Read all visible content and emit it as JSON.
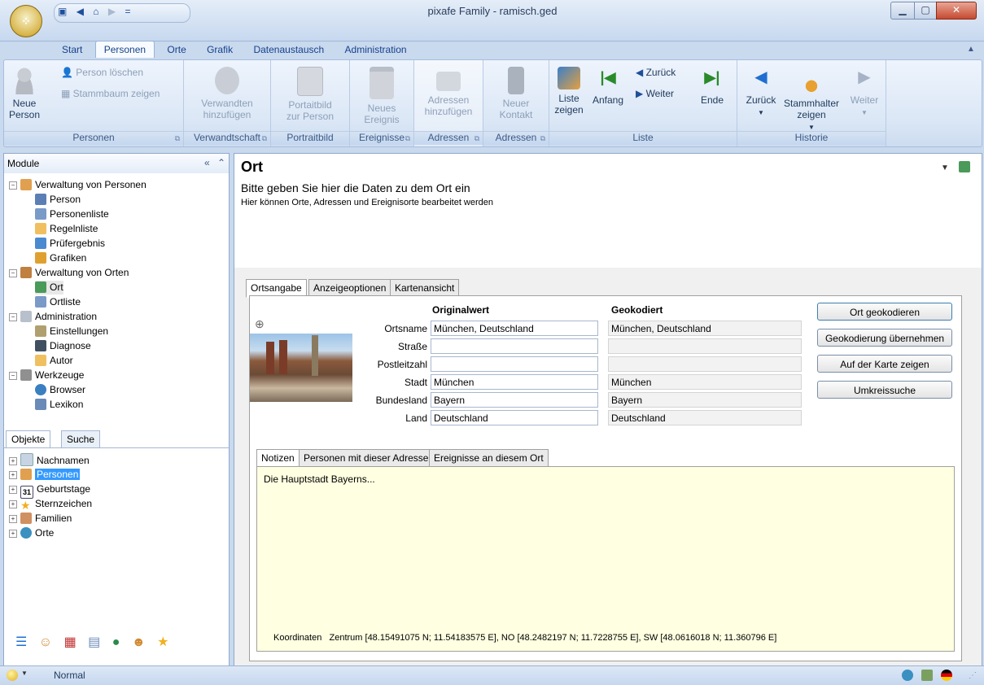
{
  "window": {
    "title": "pixafe Family - ramisch.ged"
  },
  "qat": {
    "save_icon": "save-icon",
    "back_icon": "back-arrow-icon",
    "home_icon": "home-icon",
    "forward_icon": "forward-arrow-icon",
    "customize": "="
  },
  "ribbon_tabs": [
    "Start",
    "Personen",
    "Orte",
    "Grafik",
    "Datenaustausch",
    "Administration"
  ],
  "ribbon_active_tab": "Personen",
  "ribbon": {
    "personen": {
      "label": "Personen",
      "neue_person": "Neue\nPerson",
      "person_loeschen": "Person löschen",
      "stammbaum_zeigen": "Stammbaum zeigen"
    },
    "verwandtschaft": {
      "label": "Verwandtschaft",
      "btn": "Verwandten\nhinzufügen"
    },
    "portraitbild": {
      "label": "Portraitbild",
      "btn": "Portaitbild\nzur Person"
    },
    "ereignisse": {
      "label": "Ereignisse",
      "btn": "Neues\nEreignis"
    },
    "adressen1": {
      "label": "Adressen",
      "btn": "Adressen\nhinzufügen"
    },
    "adressen2": {
      "label": "Adressen",
      "btn": "Neuer\nKontakt"
    },
    "liste": {
      "label": "Liste",
      "liste_zeigen": "Liste\nzeigen",
      "anfang": "Anfang",
      "zurueck": "Zurück",
      "weiter": "Weiter",
      "ende": "Ende"
    },
    "historie": {
      "label": "Historie",
      "zurueck": "Zurück",
      "stammhalter": "Stammhalter\nzeigen",
      "weiter": "Weiter"
    }
  },
  "modules": {
    "title": "Module",
    "tree": [
      {
        "label": "Verwaltung von Personen",
        "icon": "people-icon",
        "level": 0
      },
      {
        "label": "Person",
        "icon": "person-card-icon",
        "level": 1
      },
      {
        "label": "Personenliste",
        "icon": "list-icon",
        "level": 1
      },
      {
        "label": "Regelnliste",
        "icon": "folder-icon",
        "level": 1
      },
      {
        "label": "Prüfergebnis",
        "icon": "check-icon",
        "level": 1
      },
      {
        "label": "Grafiken",
        "icon": "chart-icon",
        "level": 1
      },
      {
        "label": "Verwaltung von Orten",
        "icon": "house-icon",
        "level": 0
      },
      {
        "label": "Ort",
        "icon": "globe-card-icon",
        "level": 1
      },
      {
        "label": "Ortliste",
        "icon": "list-icon",
        "level": 1
      },
      {
        "label": "Administration",
        "icon": "admin-icon",
        "level": 0
      },
      {
        "label": "Einstellungen",
        "icon": "settings-icon",
        "level": 1
      },
      {
        "label": "Diagnose",
        "icon": "diagnose-icon",
        "level": 1
      },
      {
        "label": "Autor",
        "icon": "folder-icon",
        "level": 1
      },
      {
        "label": "Werkzeuge",
        "icon": "tools-icon",
        "level": 0
      },
      {
        "label": "Browser",
        "icon": "globe-icon",
        "level": 1
      },
      {
        "label": "Lexikon",
        "icon": "book-icon",
        "level": 1
      }
    ]
  },
  "objects": {
    "tabs": [
      "Objekte",
      "Suche"
    ],
    "tree": [
      {
        "label": "Nachnamen",
        "icon": "name-card-icon"
      },
      {
        "label": "Personen",
        "icon": "people-icon",
        "selected": true
      },
      {
        "label": "Geburtstage",
        "icon": "calendar-icon"
      },
      {
        "label": "Sternzeichen",
        "icon": "star-icon"
      },
      {
        "label": "Familien",
        "icon": "family-icon"
      },
      {
        "label": "Orte",
        "icon": "globe-icon"
      }
    ],
    "bottom_icons": [
      "list-view-icon",
      "people-icon",
      "event-icon",
      "name-card-icon",
      "globe-icon",
      "family-icon",
      "star-icon"
    ]
  },
  "main": {
    "title": "Ort",
    "subtitle": "Bitte geben Sie hier die Daten zu dem Ort ein",
    "description": "Hier können Orte, Adressen und Ereignisorte bearbeitet werden",
    "tabs": [
      "Ortsangabe",
      "Anzeigeoptionen",
      "Kartenansicht"
    ],
    "form": {
      "col_original": "Originalwert",
      "col_geo": "Geokodiert",
      "fields": [
        {
          "label": "Ortsname",
          "value": "München, Deutschland",
          "geo": "München, Deutschland"
        },
        {
          "label": "Straße",
          "value": "",
          "geo": ""
        },
        {
          "label": "Postleitzahl",
          "value": "",
          "geo": ""
        },
        {
          "label": "Stadt",
          "value": "München",
          "geo": "München"
        },
        {
          "label": "Bundesland",
          "value": "Bayern",
          "geo": "Bayern"
        },
        {
          "label": "Land",
          "value": "Deutschland",
          "geo": "Deutschland"
        }
      ],
      "buttons": [
        "Ort geokodieren",
        "Geokodierung übernehmen",
        "Auf der Karte zeigen",
        "Umkreissuche"
      ]
    },
    "subtabs": [
      "Notizen",
      "Personen mit dieser Adresse",
      "Ereignisse an diesem Ort"
    ],
    "notes": "Die Hauptstadt Bayerns...",
    "coordinates_label": "Koordinaten",
    "coordinates_value": "Zentrum [48.15491075 N; 11.54183575 E], NO [48.2482197 N; 11.7228755 E], SW [48.0616018 N; 11.360796 E]"
  },
  "status": {
    "mode": "Normal"
  }
}
